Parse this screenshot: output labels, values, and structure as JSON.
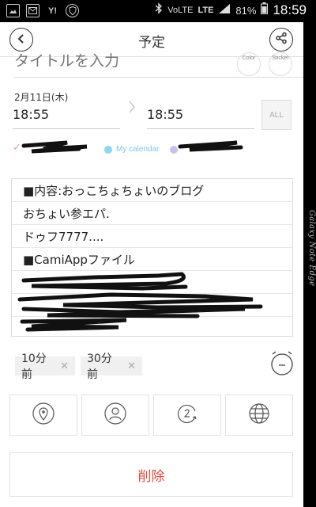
{
  "status_bar": {
    "notif_icons": [
      "image-icon",
      "mail-icon",
      "yahoo-icon",
      "shield-icon"
    ],
    "yahoo_text": "Y!",
    "volte": "VoLTE",
    "lte": "LTE",
    "battery_percent": "81%",
    "time": "18:59"
  },
  "header": {
    "title": "予定"
  },
  "title_field": {
    "placeholder": "タイトルを入力",
    "color_label": "Color",
    "sticker_label": "Sticker"
  },
  "datetime": {
    "date": "2月11日(木)",
    "start_time": "18:55",
    "end_time": "18:55",
    "all_day_label": "ALL"
  },
  "calendars": {
    "selected_mark": "✓",
    "items": [
      {
        "name": "My calendar",
        "color": "#8ad8f2"
      }
    ],
    "other_color": "#c3c4f0"
  },
  "notes": {
    "lines": [
      "■内容:おっこちょちょいのブログ",
      "おちょい参エパ.",
      "ドゥフ7777....",
      "■CamiAppファイル",
      "",
      "",
      ""
    ]
  },
  "reminders": {
    "items": [
      "10分前",
      "30分前"
    ],
    "remove_glyph": "✕"
  },
  "options": [
    "location-icon",
    "person-icon",
    "repeat-icon",
    "globe-icon"
  ],
  "delete_label": "削除",
  "edge_label": "Galaxy Note Edge",
  "colors": {
    "accent_red": "#e34c3f",
    "calendar_blue": "#8ad8f2",
    "calendar_purple": "#c3c4f0"
  }
}
